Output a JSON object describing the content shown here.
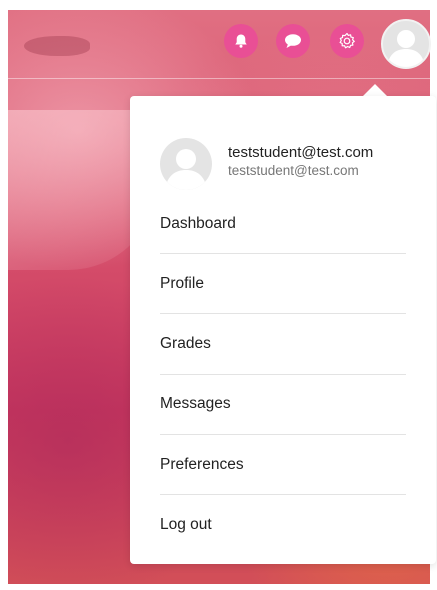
{
  "header": {
    "icons": [
      {
        "name": "notifications-icon"
      },
      {
        "name": "messages-icon"
      },
      {
        "name": "settings-icon"
      }
    ],
    "accent_color": "#e94f95"
  },
  "user_menu": {
    "user": {
      "name": "teststudent@test.com",
      "email": "teststudent@test.com"
    },
    "items": [
      {
        "label": "Dashboard"
      },
      {
        "label": "Profile"
      },
      {
        "label": "Grades"
      },
      {
        "label": "Messages"
      },
      {
        "label": "Preferences"
      },
      {
        "label": "Log out"
      }
    ]
  }
}
